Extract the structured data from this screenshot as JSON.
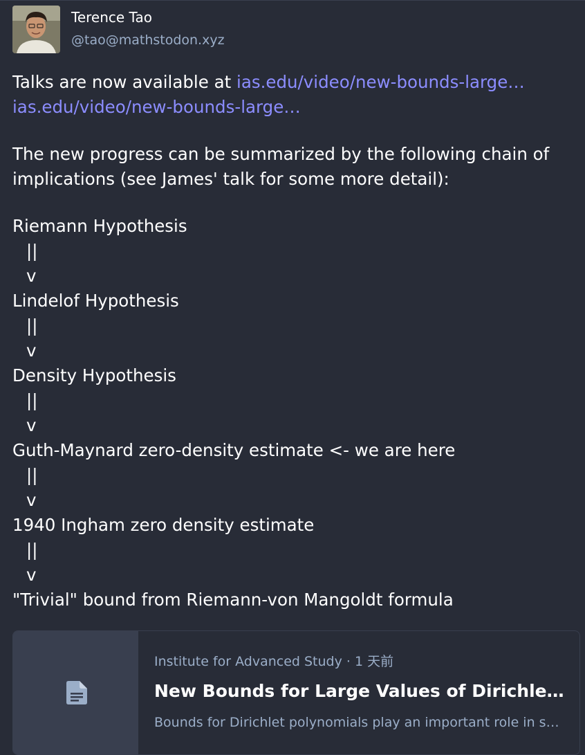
{
  "author": {
    "display_name": "Terence Tao",
    "handle": "@tao@mathstodon.xyz"
  },
  "post": {
    "intro_text": "Talks are now available at ",
    "links": [
      "ias.edu/video/new-bounds-large…",
      "ias.edu/video/new-bounds-large…"
    ],
    "summary_line_1": "The new progress can be summarized by the following chain of",
    "summary_line_2": "implications (see James' talk for some more detail):",
    "chain": [
      "Riemann Hypothesis",
      "Lindelof Hypothesis",
      "Density Hypothesis",
      "Guth-Maynard zero-density estimate <- we are here",
      "1940 Ingham zero density estimate",
      "\"Trivial\" bound from Riemann-von Mangoldt formula"
    ],
    "arrow_bar": "||",
    "arrow_head": "v"
  },
  "card": {
    "icon": "document-icon",
    "source": "Institute for Advanced Study",
    "separator": " · ",
    "time": "1 天前",
    "title": "New Bounds for Large Values of Dirichlet Polynomials",
    "description": "Bounds for Dirichlet polynomials play an important role in several areas of analytic number theory."
  },
  "colors": {
    "background": "#282c37",
    "link": "#8c8dff",
    "secondary_text": "#9baec8",
    "card_thumb": "#393f4f"
  }
}
